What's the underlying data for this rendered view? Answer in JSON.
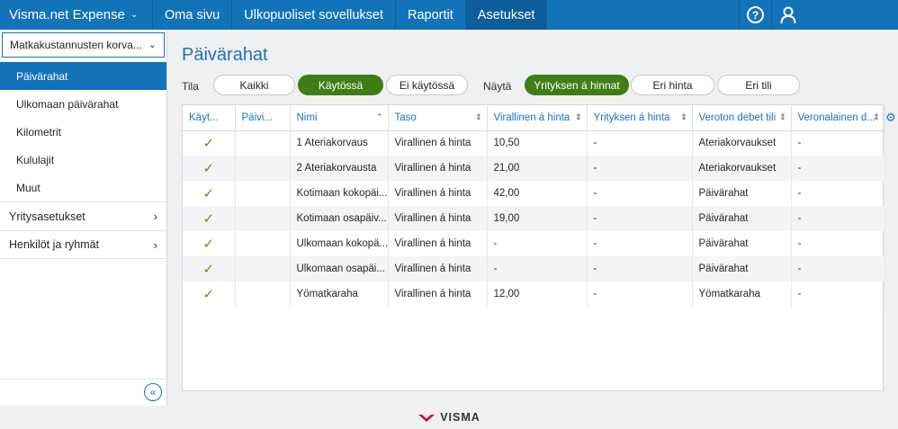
{
  "app": {
    "brand": "Visma.net Expense"
  },
  "nav": {
    "items": [
      "Oma sivu",
      "Ulkopuoliset sovellukset",
      "Raportit",
      "Asetukset"
    ]
  },
  "sidebar": {
    "select": "Matkakustannusten korva...",
    "items": [
      "Päivärahat",
      "Ulkomaan päivärahat",
      "Kilometrit",
      "Kululajit",
      "Muut"
    ],
    "groups": [
      "Yritysasetukset",
      "Henkilöt ja ryhmät"
    ]
  },
  "main": {
    "title": "Päivärahat",
    "filters": {
      "tila_label": "Tila",
      "tila_options": [
        "Kaikki",
        "Käytössä",
        "Ei käytössä"
      ],
      "nayta_label": "Näytä",
      "nayta_options": [
        "Yrityksen á hinnat",
        "Eri hinta",
        "Eri tili"
      ]
    },
    "table": {
      "columns": [
        "Käyt...",
        "Päivi...",
        "Nimi",
        "Taso",
        "Virallinen á hinta",
        "Yrityksen á hinta",
        "Veroton debet tili",
        "Veronalainen d..."
      ],
      "rows": [
        [
          "1 Ateriakorvaus",
          "Virallinen á hinta",
          "10,50",
          "-",
          "Ateriakorvaukset",
          "-"
        ],
        [
          "2 Ateriakorvausta",
          "Virallinen á hinta",
          "21,00",
          "-",
          "Ateriakorvaukset",
          "-"
        ],
        [
          "Kotimaan kokopäi...",
          "Virallinen á hinta",
          "42,00",
          "-",
          "Päivärahat",
          "-"
        ],
        [
          "Kotimaan osapäiv...",
          "Virallinen á hinta",
          "19,00",
          "-",
          "Päivärahat",
          "-"
        ],
        [
          "Ulkomaan kokopä...",
          "Virallinen á hinta",
          "-",
          "-",
          "Päivärahat",
          "-"
        ],
        [
          "Ulkomaan osapäi...",
          "Virallinen á hinta",
          "-",
          "-",
          "Päivärahat",
          "-"
        ],
        [
          "Yömatkaraha",
          "Virallinen á hinta",
          "12,00",
          "-",
          "Yömatkaraha",
          "-"
        ]
      ]
    }
  },
  "footer": {
    "logo": "VISMA"
  },
  "colors": {
    "accent": "#1373b9",
    "active_pill": "#3f7d16",
    "check": "#4e9a1d",
    "title": "#1a74b6"
  }
}
